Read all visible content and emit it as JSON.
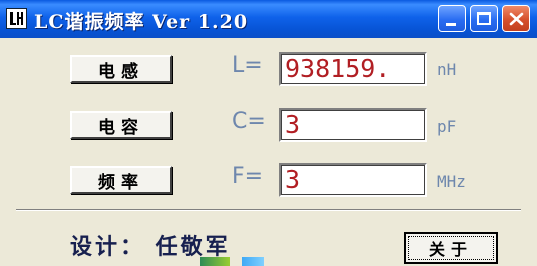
{
  "window": {
    "title": "LC谐振频率 Ver 1.20"
  },
  "fields": [
    {
      "button_label": "电感",
      "symbol": "L=",
      "value": "938159.",
      "unit": "nH"
    },
    {
      "button_label": "电容",
      "symbol": "C=",
      "value": "3",
      "unit": "pF"
    },
    {
      "button_label": "频率",
      "symbol": "F=",
      "value": "3",
      "unit": "MHz"
    }
  ],
  "footer": {
    "design_text": "设计： 任敬军",
    "about_label": "关于"
  },
  "colors": {
    "title_bar": "#0A5AE0",
    "value_text": "#B11E23",
    "label_text": "#6E87AD",
    "window_bg": "#ECE9D8"
  },
  "icons": [
    "app-icon",
    "minimize-icon",
    "maximize-icon",
    "close-icon"
  ]
}
